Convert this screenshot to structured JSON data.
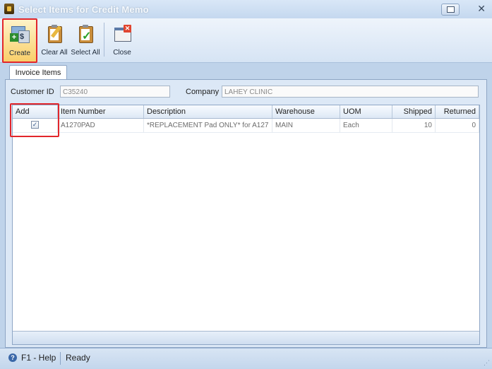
{
  "window": {
    "title": "Select Items for Credit Memo"
  },
  "toolbar": {
    "create_label": "Create",
    "clear_all_label": "Clear All",
    "select_all_label": "Select All",
    "close_label": "Close"
  },
  "tabs": [
    {
      "label": "Invoice Items"
    }
  ],
  "form": {
    "customer_id_label": "Customer ID",
    "customer_id_value": "C35240",
    "company_label": "Company",
    "company_value": "LAHEY CLINIC"
  },
  "grid": {
    "columns": [
      "Add",
      "Item Number",
      "Description",
      "Warehouse",
      "UOM",
      "Shipped",
      "Returned"
    ],
    "rows": [
      {
        "add": true,
        "item_number": "A1270PAD",
        "description": "*REPLACEMENT Pad ONLY*  for A127",
        "warehouse": "MAIN",
        "uom": "Each",
        "shipped": "10",
        "returned": "0"
      }
    ]
  },
  "status": {
    "help": "F1 - Help",
    "state": "Ready"
  },
  "colors": {
    "highlight": "#e2262b",
    "accent": "#3a67a8"
  },
  "icons": {
    "create": "create-icon",
    "clear_all": "clear-all-icon",
    "select_all": "select-all-icon",
    "close": "close-icon"
  }
}
